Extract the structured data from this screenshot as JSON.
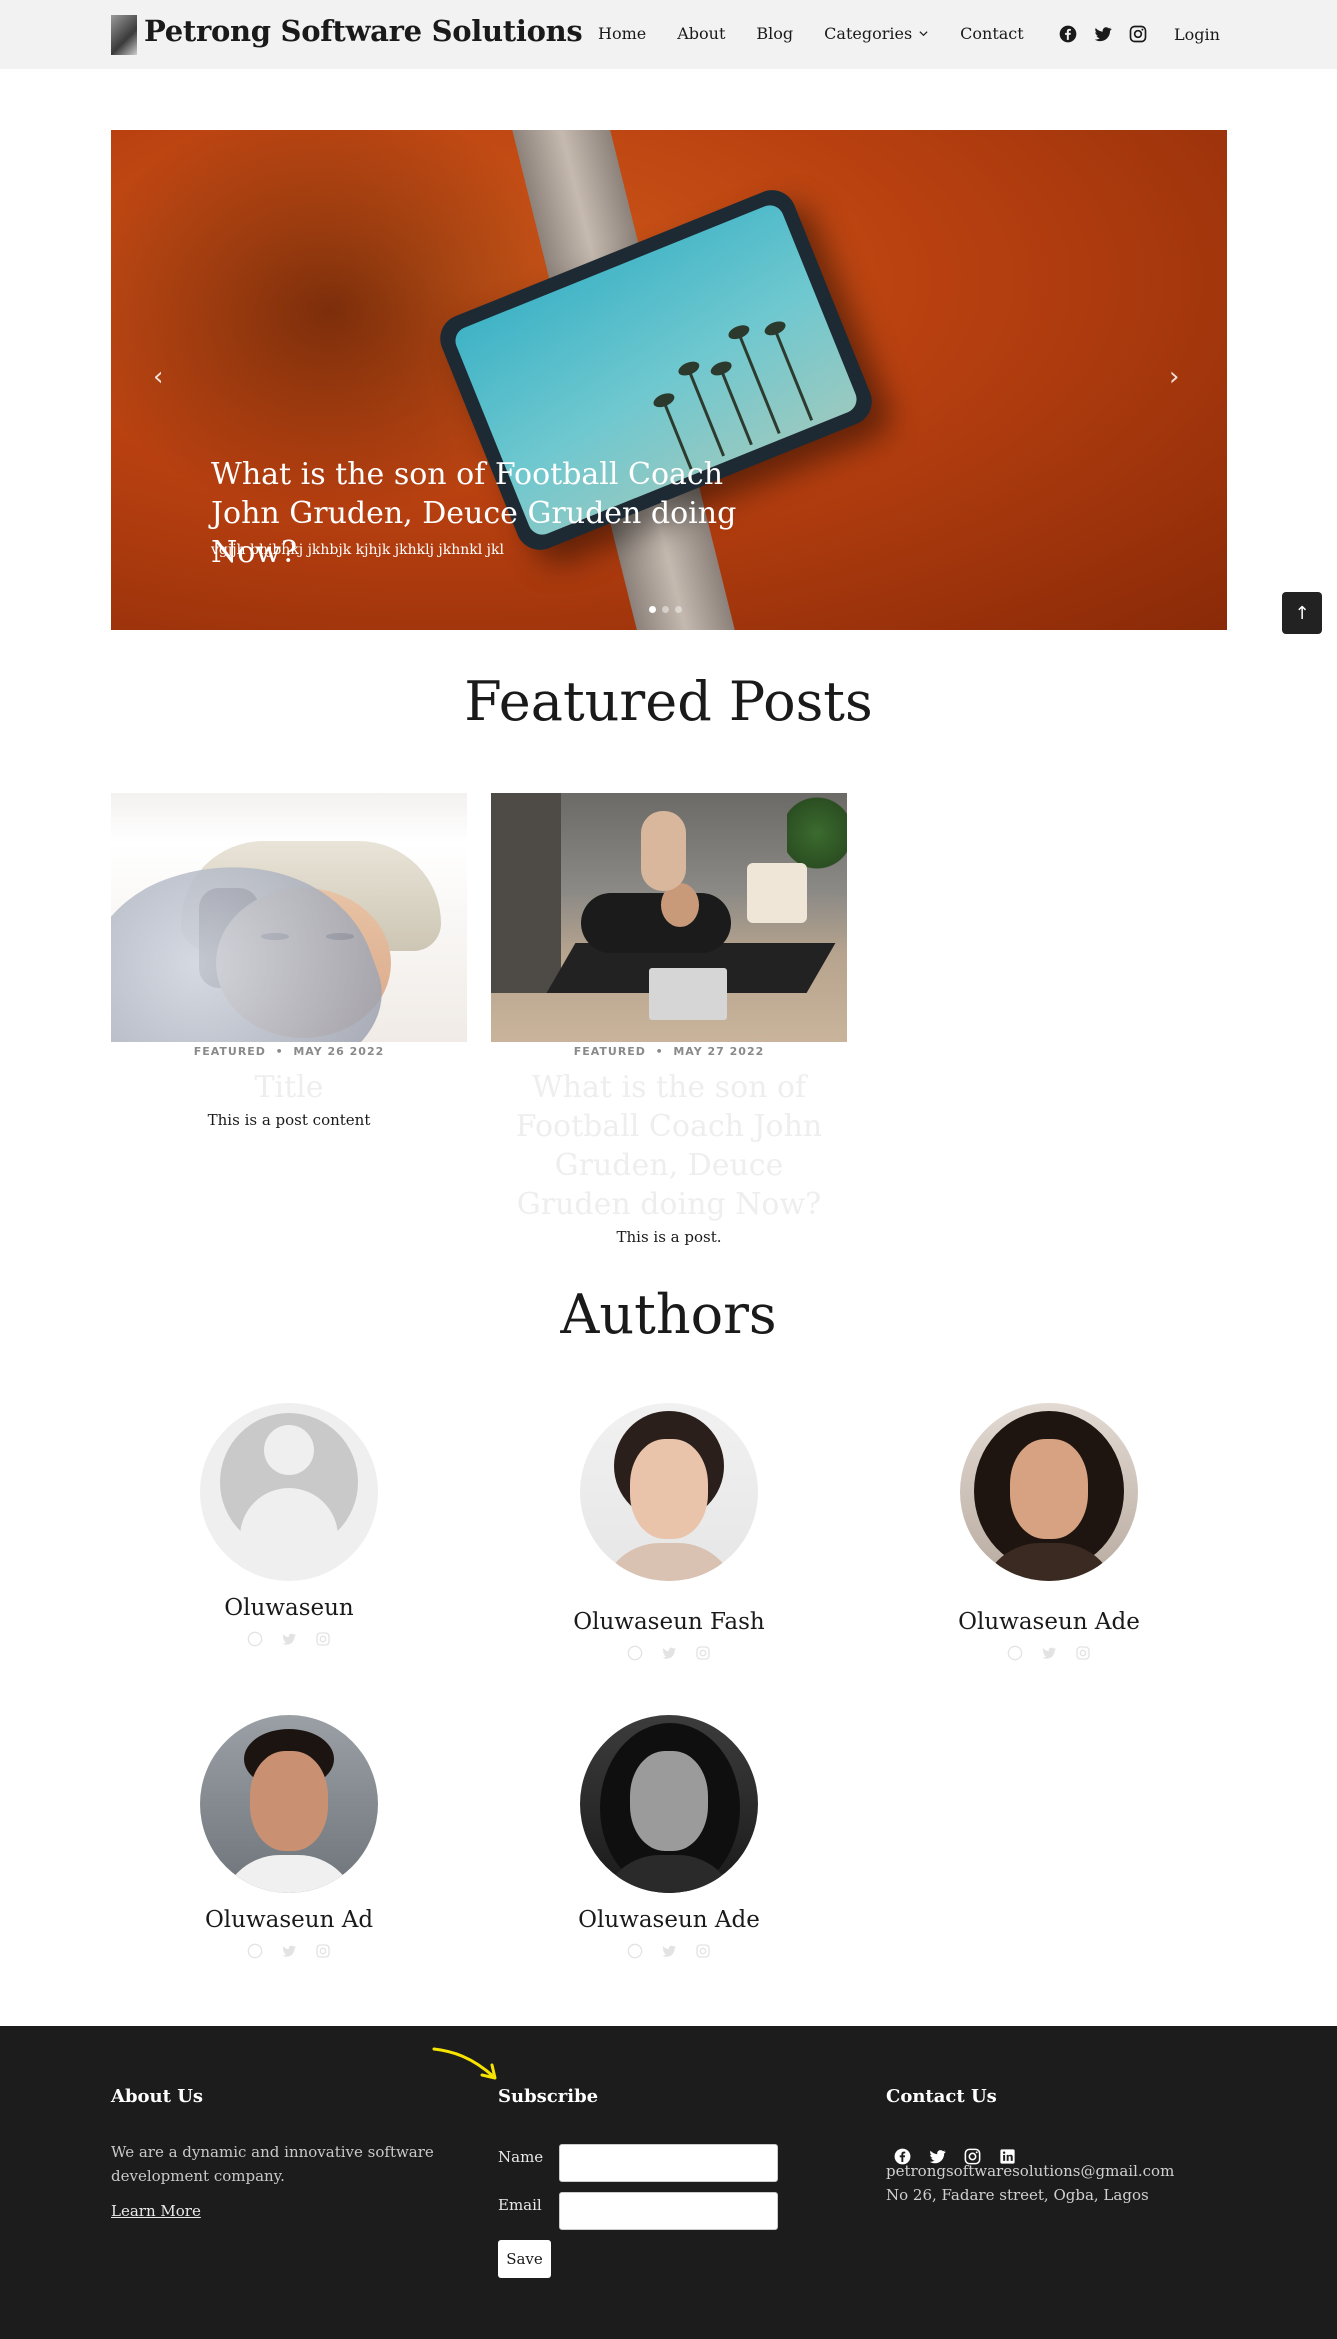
{
  "header": {
    "brand": "Petrong Software Solutions",
    "nav": [
      "Home",
      "About",
      "Blog",
      "Categories",
      "Contact"
    ],
    "social_icons": [
      "facebook-icon",
      "twitter-icon",
      "instagram-icon"
    ],
    "login": "Login"
  },
  "hero": {
    "title": "What is the son of Football Coach John Gruden, Deuce Gruden doing Now?",
    "subtitle": "vgjjh bhjbhkj jkhbjk kjhjk jkhklj jkhnkl jkl",
    "slide_count": 3,
    "active_slide": 1
  },
  "featured": {
    "heading": "Featured Posts",
    "posts": [
      {
        "category": "FEATURED",
        "date": "MAY 26 2022",
        "title": "Title",
        "content": "This is a post content"
      },
      {
        "category": "FEATURED",
        "date": "MAY 27 2022",
        "title": "What is the son of Football Coach John Gruden, Deuce Gruden doing Now?",
        "content": "This is a post."
      }
    ]
  },
  "authors": {
    "heading": "Authors",
    "items": [
      {
        "name": "Oluwaseun"
      },
      {
        "name": "Oluwaseun Fash"
      },
      {
        "name": "Oluwaseun Ade"
      },
      {
        "name": "Oluwaseun Ad"
      },
      {
        "name": "Oluwaseun Ade"
      }
    ]
  },
  "footer": {
    "about_title": "About Us",
    "about_text": "We are a dynamic and innovative software development company.",
    "learn_more": "Learn More",
    "subscribe_title": "Subscribe",
    "name_label": "Name",
    "email_label": "Email",
    "save_label": "Save",
    "contact_title": "Contact Us",
    "email": "petrongsoftwaresolutions@gmail.com",
    "address": "No 26, Fadare street, Ogba, Lagos",
    "social_icons": [
      "facebook-icon",
      "twitter-icon",
      "instagram-icon",
      "linkedin-icon"
    ]
  },
  "colors": {
    "footer_bg": "#1c1c1c",
    "header_bg": "#f2f2f2",
    "annotation": "#f5e300"
  }
}
